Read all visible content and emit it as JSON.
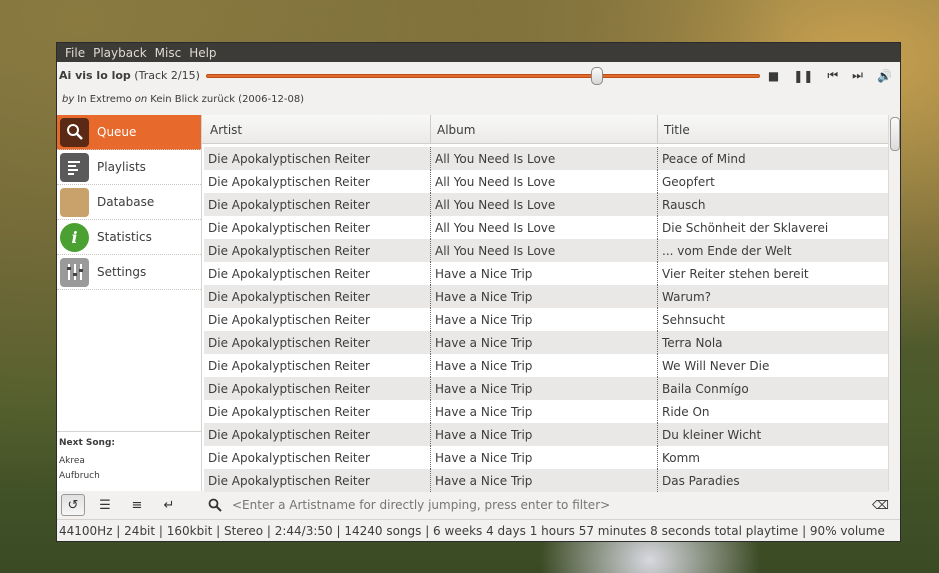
{
  "menu": [
    "File",
    "Playback",
    "Misc",
    "Help"
  ],
  "now_playing": {
    "title": "Ai vis lo lop",
    "track": "(Track 2/15)",
    "by_prefix": "by",
    "artist": "In Extremo",
    "on_prefix": "on",
    "album": "Kein Blick zurück (2006-12-08)",
    "progress_fraction": 0.71
  },
  "controls": {
    "stop": "■",
    "pause": "❚❚",
    "prev": "⏮",
    "next": "⏭",
    "volume": "🔊"
  },
  "sidebar": {
    "items": [
      {
        "label": "Queue",
        "icon": "search-icon",
        "active": true
      },
      {
        "label": "Playlists",
        "icon": "playlist-icon",
        "active": false
      },
      {
        "label": "Database",
        "icon": "database-icon",
        "active": false
      },
      {
        "label": "Statistics",
        "icon": "info-icon",
        "active": false
      },
      {
        "label": "Settings",
        "icon": "sliders-icon",
        "active": false
      }
    ],
    "next_song_label": "Next Song:",
    "next_song_artist": "Akrea",
    "next_song_title": "Aufbruch"
  },
  "table": {
    "columns": [
      "Artist",
      "Album",
      "Title"
    ],
    "rows": [
      [
        "Die Apokalyptischen Reiter",
        "All You Need Is Love",
        "Peace of Mind"
      ],
      [
        "Die Apokalyptischen Reiter",
        "All You Need Is Love",
        "Geopfert"
      ],
      [
        "Die Apokalyptischen Reiter",
        "All You Need Is Love",
        "Rausch"
      ],
      [
        "Die Apokalyptischen Reiter",
        "All You Need Is Love",
        "Die Schönheit der Sklaverei"
      ],
      [
        "Die Apokalyptischen Reiter",
        "All You Need Is Love",
        "... vom Ende der Welt"
      ],
      [
        "Die Apokalyptischen Reiter",
        "Have a Nice Trip",
        "Vier Reiter stehen bereit"
      ],
      [
        "Die Apokalyptischen Reiter",
        "Have a Nice Trip",
        "Warum?"
      ],
      [
        "Die Apokalyptischen Reiter",
        "Have a Nice Trip",
        "Sehnsucht"
      ],
      [
        "Die Apokalyptischen Reiter",
        "Have a Nice Trip",
        "Terra Nola"
      ],
      [
        "Die Apokalyptischen Reiter",
        "Have a Nice Trip",
        "We Will Never Die"
      ],
      [
        "Die Apokalyptischen Reiter",
        "Have a Nice Trip",
        "Baila Conmígo"
      ],
      [
        "Die Apokalyptischen Reiter",
        "Have a Nice Trip",
        "Ride On"
      ],
      [
        "Die Apokalyptischen Reiter",
        "Have a Nice Trip",
        "Du kleiner Wicht"
      ],
      [
        "Die Apokalyptischen Reiter",
        "Have a Nice Trip",
        "Komm"
      ],
      [
        "Die Apokalyptischen Reiter",
        "Have a Nice Trip",
        "Das Paradies"
      ]
    ]
  },
  "search": {
    "placeholder": "<Enter a Artistname for directly jumping, press enter to filter>"
  },
  "queue_buttons": [
    "repeat-icon",
    "random-icon",
    "consume-icon",
    "single-icon"
  ],
  "status": "44100Hz | 24bit | 160kbit | Stereo | 2:44/3:50 | 14240 songs | 6 weeks 4 days 1 hours 57 minutes 8 seconds total playtime | 90% volume"
}
